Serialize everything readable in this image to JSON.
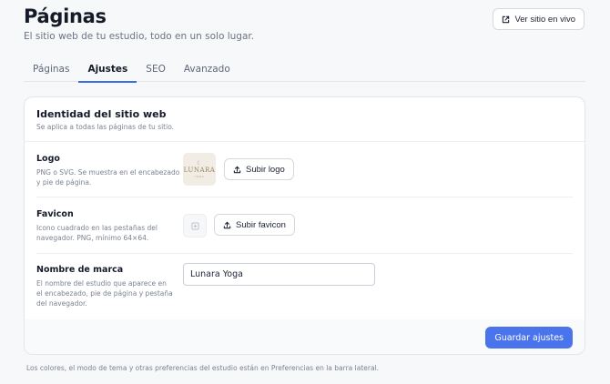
{
  "header": {
    "title": "Páginas",
    "subtitle": "El sitio web de tu estudio, todo en un solo lugar.",
    "live_button": "Ver sitio en vivo"
  },
  "tabs": [
    {
      "label": "Páginas",
      "active": false
    },
    {
      "label": "Ajustes",
      "active": true
    },
    {
      "label": "SEO",
      "active": false
    },
    {
      "label": "Avanzado",
      "active": false
    }
  ],
  "identity": {
    "title": "Identidad del sitio web",
    "subtitle": "Se aplica a todas las páginas de tu sitio.",
    "logo": {
      "label": "Logo",
      "help": "PNG o SVG. Se muestra en el encabezado y pie de página.",
      "preview_text": "LUNARA",
      "preview_subtext": "YOGA",
      "button": "Subir logo"
    },
    "favicon": {
      "label": "Favicon",
      "help": "Icono cuadrado en las pestañas del navegador. PNG, mínimo 64×64.",
      "button": "Subir favicon"
    },
    "brand_name": {
      "label": "Nombre de marca",
      "help": "El nombre del estudio que aparece en el encabezado, pie de página y pestaña del navegador.",
      "value": "Lunara Yoga"
    },
    "save_button": "Guardar ajustes"
  },
  "footnote": "Los colores, el modo de tema y otras preferencias del estudio están en Preferencias en la barra lateral.",
  "colors": {
    "accent": "#4a74ec",
    "tab_indicator": "#3d6be8",
    "logo_background": "#f1ece4"
  },
  "icons": {
    "live_button": "external-link-icon",
    "upload": "upload-icon",
    "favicon_placeholder": "image-placeholder-icon",
    "logo_moon": "crescent-moon-icon"
  }
}
